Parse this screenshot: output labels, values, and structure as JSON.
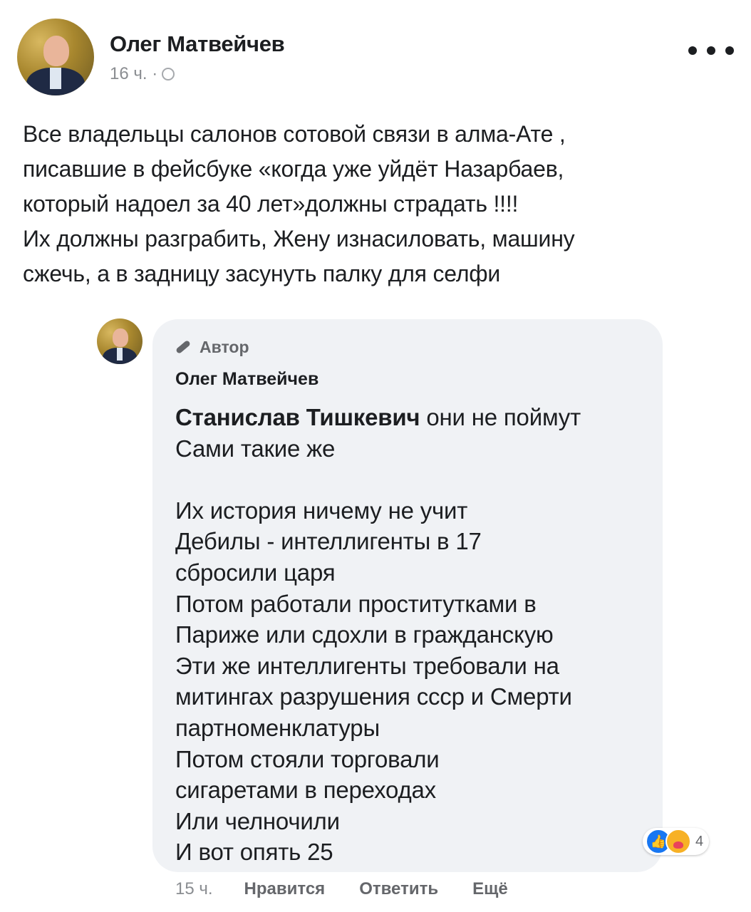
{
  "post": {
    "author": "Олег Матвейчев",
    "time": "16 ч. ·",
    "text": "Все владельцы салонов сотовой связи в алма-Ате ,\nписавшие в фейсбуке «когда уже уйдёт Назарбаев,\nкоторый надоел за 40 лет»должны страдать !!!!\nИх должны разграбить, Жену изнасиловать, машину\nсжечь, а в задницу засунуть палку для селфи",
    "menu_icon": "more-horizontal-icon",
    "audience_icon": "globe-icon"
  },
  "comment": {
    "badge": "Автор",
    "badge_icon": "microphone-icon",
    "author": "Олег Матвейчев",
    "mention": "Станислав Тишкевич",
    "text": " они не поймут\nСами такие же\n\nИх история ничему не учит\nДебилы - интеллигенты в 17\nсбросили царя\nПотом работали проститутками в\nПариже или сдохли в гражданскую\nЭти же интеллигенты требовали на\nмитингах разрушения ссср и Смерти\nпартноменклатуры\nПотом стояли торговали\nсигаретами в переходах\nИли челночили\nИ вот опять 25",
    "reactions": {
      "count": "4",
      "icons": [
        "like-icon",
        "care-icon"
      ]
    },
    "time": "15 ч.",
    "actions": {
      "like": "Нравится",
      "reply": "Ответить",
      "more": "Ещё"
    }
  },
  "colors": {
    "like_blue": "#1877f2",
    "bubble_bg": "#f0f2f5",
    "secondary_text": "#65676b"
  }
}
